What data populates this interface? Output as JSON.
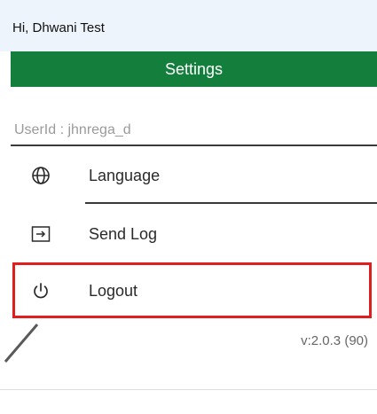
{
  "header": {
    "greeting": "Hi, Dhwani Test",
    "title": "Settings"
  },
  "user": {
    "userid_text": "UserId : jhnrega_d"
  },
  "menu": {
    "items": [
      {
        "label": "Language",
        "icon": "globe-icon"
      },
      {
        "label": "Send Log",
        "icon": "send-log-icon"
      },
      {
        "label": "Logout",
        "icon": "power-icon"
      }
    ]
  },
  "footer": {
    "version": "v:2.0.3 (90)"
  },
  "colors": {
    "header_green": "#147f3c",
    "highlight_red": "#e01e1e",
    "greeting_bar": "#eef4fb"
  }
}
